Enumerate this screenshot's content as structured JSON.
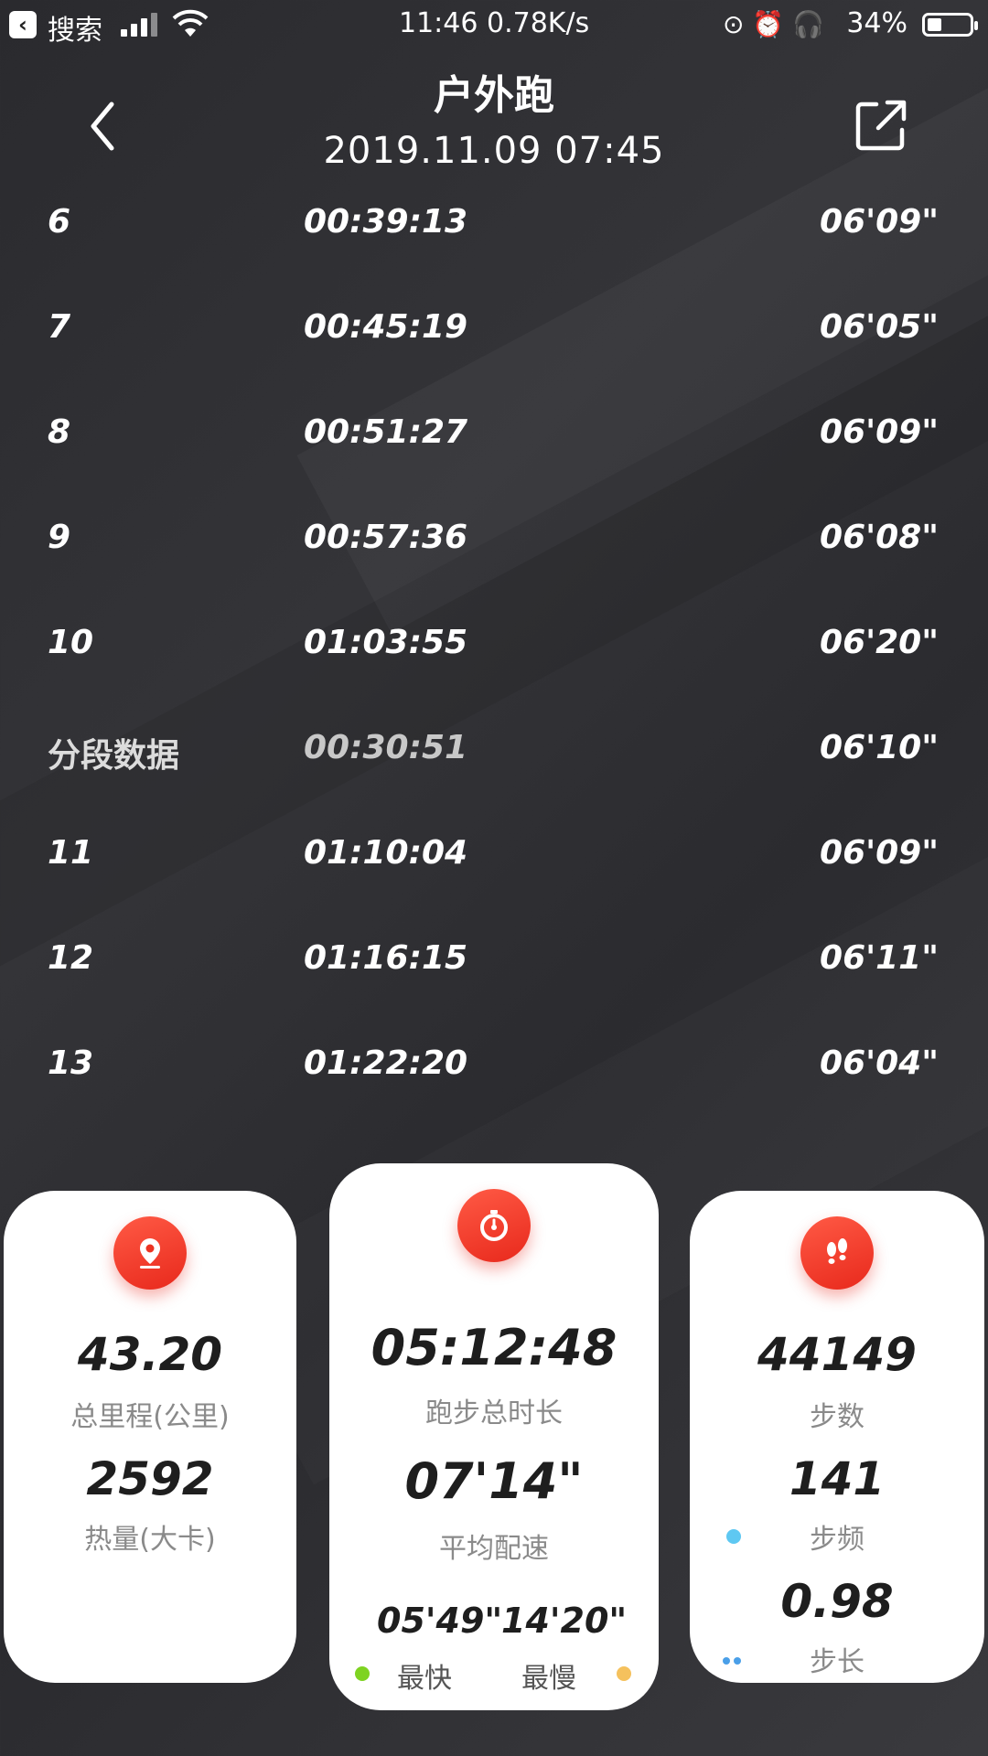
{
  "status_bar": {
    "back_app": "搜索",
    "time_speed": "11:46 0.78K/s",
    "battery": "34%",
    "battery_level": 0.34
  },
  "header": {
    "title": "户外跑",
    "datetime": "2019.11.09 07:45"
  },
  "splits": [
    {
      "km": "6",
      "time": "00:39:13",
      "pace": "06'09\""
    },
    {
      "km": "7",
      "time": "00:45:19",
      "pace": "06'05\""
    },
    {
      "km": "8",
      "time": "00:51:27",
      "pace": "06'09\""
    },
    {
      "km": "9",
      "time": "00:57:36",
      "pace": "06'08\""
    },
    {
      "km": "10",
      "time": "01:03:55",
      "pace": "06'20\""
    },
    {
      "km": "分段数据",
      "time": "00:30:51",
      "pace": "06'10\""
    },
    {
      "km": "11",
      "time": "01:10:04",
      "pace": "06'09\""
    },
    {
      "km": "12",
      "time": "01:16:15",
      "pace": "06'11\""
    },
    {
      "km": "13",
      "time": "01:22:20",
      "pace": "06'04\""
    }
  ],
  "cards": {
    "distance": {
      "value": "43.20",
      "label": "总里程(公里)",
      "calories": "2592",
      "calories_label": "热量(大卡)"
    },
    "duration": {
      "value": "05:12:48",
      "label": "跑步总时长",
      "avg_pace": "07'14\"",
      "avg_pace_label": "平均配速",
      "fastest": "05'49\"",
      "slowest": "14'20\"",
      "fastest_label": "最快",
      "slowest_label": "最慢"
    },
    "steps": {
      "value": "44149",
      "label": "步数",
      "cadence": "141",
      "cadence_label": "步频",
      "stride": "0.98",
      "stride_label": "步长"
    }
  },
  "colors": {
    "accent_red": "#ec3322",
    "fastest_dot": "#7ed321",
    "slowest_dot": "#f5c15d",
    "cadence_dot": "#5ec8f2",
    "stride_dot": "#4a9fe8"
  }
}
